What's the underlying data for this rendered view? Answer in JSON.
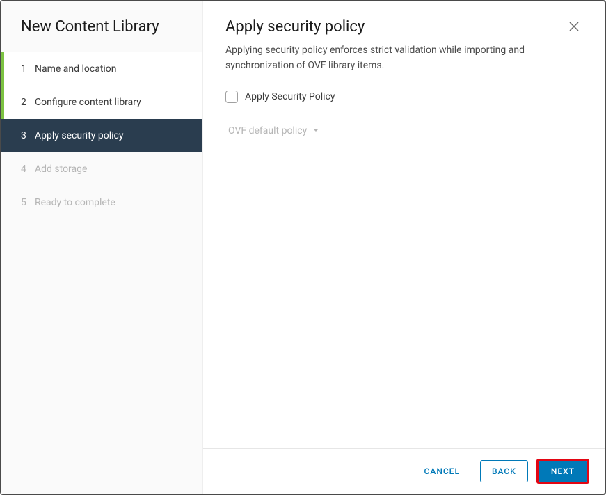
{
  "wizard": {
    "title": "New Content Library",
    "steps": [
      {
        "num": "1",
        "label": "Name and location",
        "state": "completed"
      },
      {
        "num": "2",
        "label": "Configure content library",
        "state": "completed"
      },
      {
        "num": "3",
        "label": "Apply security policy",
        "state": "active"
      },
      {
        "num": "4",
        "label": "Add storage",
        "state": "disabled"
      },
      {
        "num": "5",
        "label": "Ready to complete",
        "state": "disabled"
      }
    ]
  },
  "main": {
    "title": "Apply security policy",
    "description": "Applying security policy enforces strict validation while importing and synchronization of OVF library items.",
    "checkbox_label": "Apply Security Policy",
    "dropdown_value": "OVF default policy"
  },
  "footer": {
    "cancel": "CANCEL",
    "back": "BACK",
    "next": "NEXT"
  }
}
